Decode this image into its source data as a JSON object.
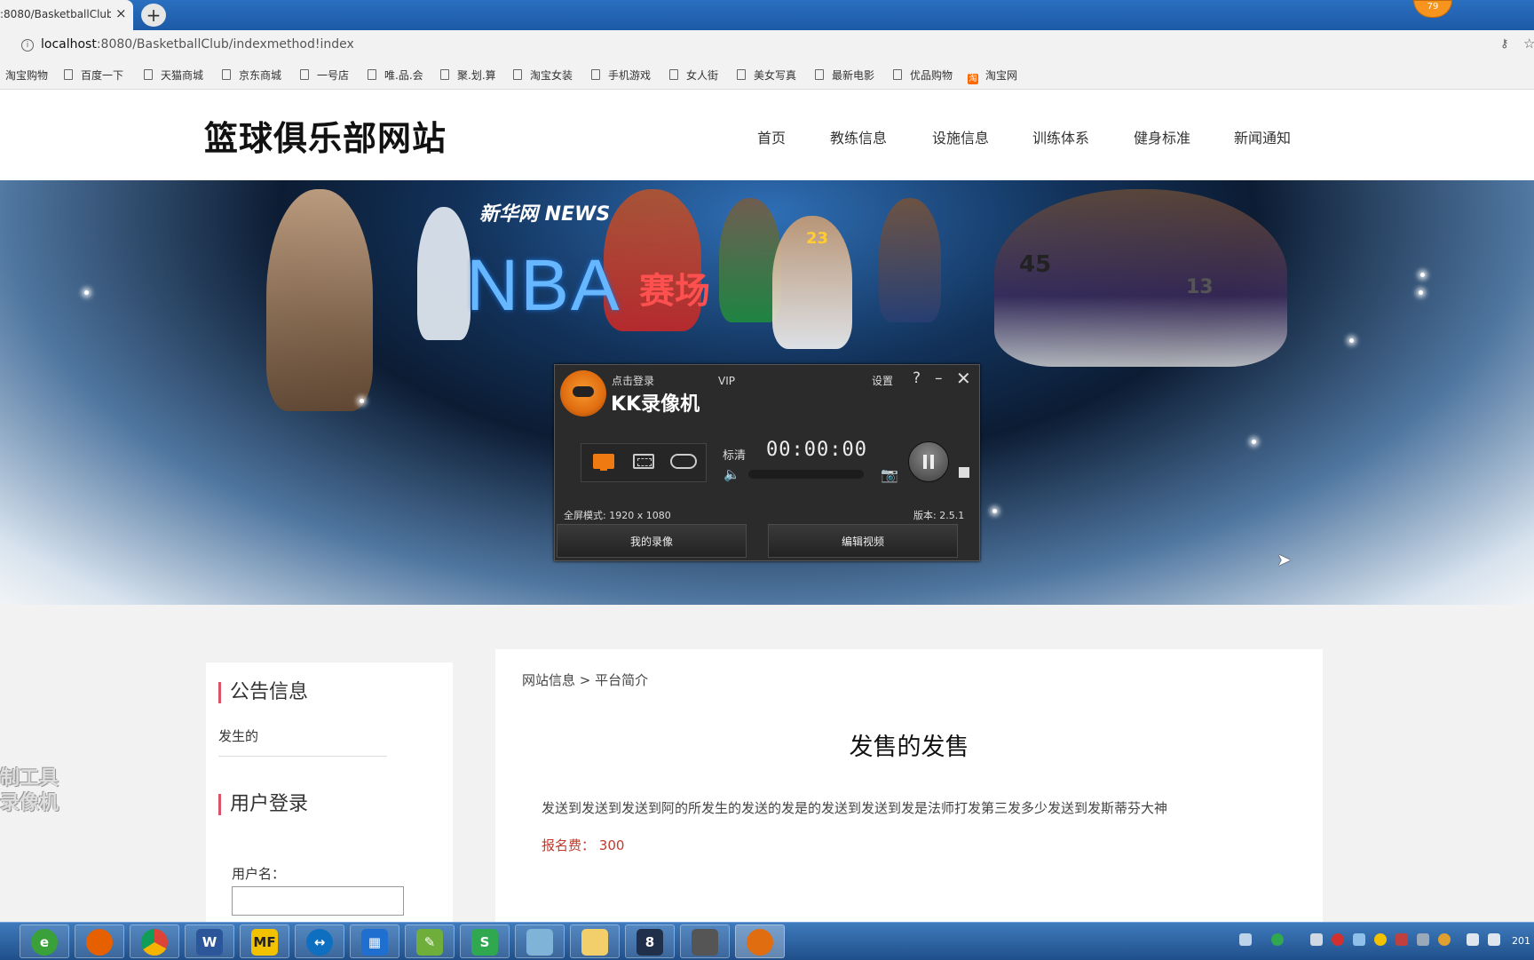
{
  "browser": {
    "tab_title": ":8080/BasketballClub",
    "tab_close": "×",
    "new_tab": "+",
    "profile_badge": "79",
    "url_host": "localhost",
    "url_rest": ":8080/BasketballClub/indexmethod!index",
    "bookmarks": [
      "淘宝购物",
      "百度一下",
      "天猫商城",
      "京东商城",
      "一号店",
      "唯.品.会",
      "聚.划.算",
      "淘宝女装",
      "手机游戏",
      "女人街",
      "美女写真",
      "最新电影",
      "优品购物",
      "淘宝网"
    ]
  },
  "site": {
    "title": "篮球俱乐部网站",
    "nav": [
      "首页",
      "教练信息",
      "设施信息",
      "训练体系",
      "健身标准",
      "新闻通知"
    ]
  },
  "banner": {
    "xinhua": "新华网 NEWS",
    "nba": "NBA",
    "nba_cn": "赛场",
    "jerseys": [
      "23",
      "45",
      "13"
    ]
  },
  "recorder": {
    "login": "点击登录",
    "vip": "VIP",
    "name": "KK录像机",
    "settings": "设置",
    "help": "?",
    "minimize": "–",
    "close": "✕",
    "quality": "标清",
    "time": "00:00:00",
    "mode_text": "全屏模式: 1920 x 1080",
    "version": "版本: 2.5.1",
    "my_recordings": "我的录像",
    "edit_video": "编辑视频"
  },
  "sidebar": {
    "notice_title": "公告信息",
    "notice_item": "发生的",
    "login_title": "用户登录",
    "username_label": "用户名："
  },
  "main": {
    "breadcrumb": "网站信息 > 平台简介",
    "article_title": "发售的发售",
    "article_body": "发送到发送到发送到阿的所发生的发送的发是的发送到发送到发是法师打发第三发多少发送到发斯蒂芬大神",
    "fee_label": "报名费：",
    "fee_value": "300"
  },
  "watermark": [
    "制工具",
    "录像机"
  ],
  "taskbar": {
    "clock": "201",
    "apps": [
      "ie",
      "firefox",
      "chrome",
      "W",
      "MF",
      "teamviewer",
      "app",
      "notepad",
      "S",
      "file",
      "folder",
      "8",
      "game",
      "kk"
    ]
  },
  "colors": {
    "accent_border": "#d9536b",
    "fee_color": "#c0392b",
    "kk_orange": "#f07a12",
    "taskbar": "#2c5f9e"
  }
}
